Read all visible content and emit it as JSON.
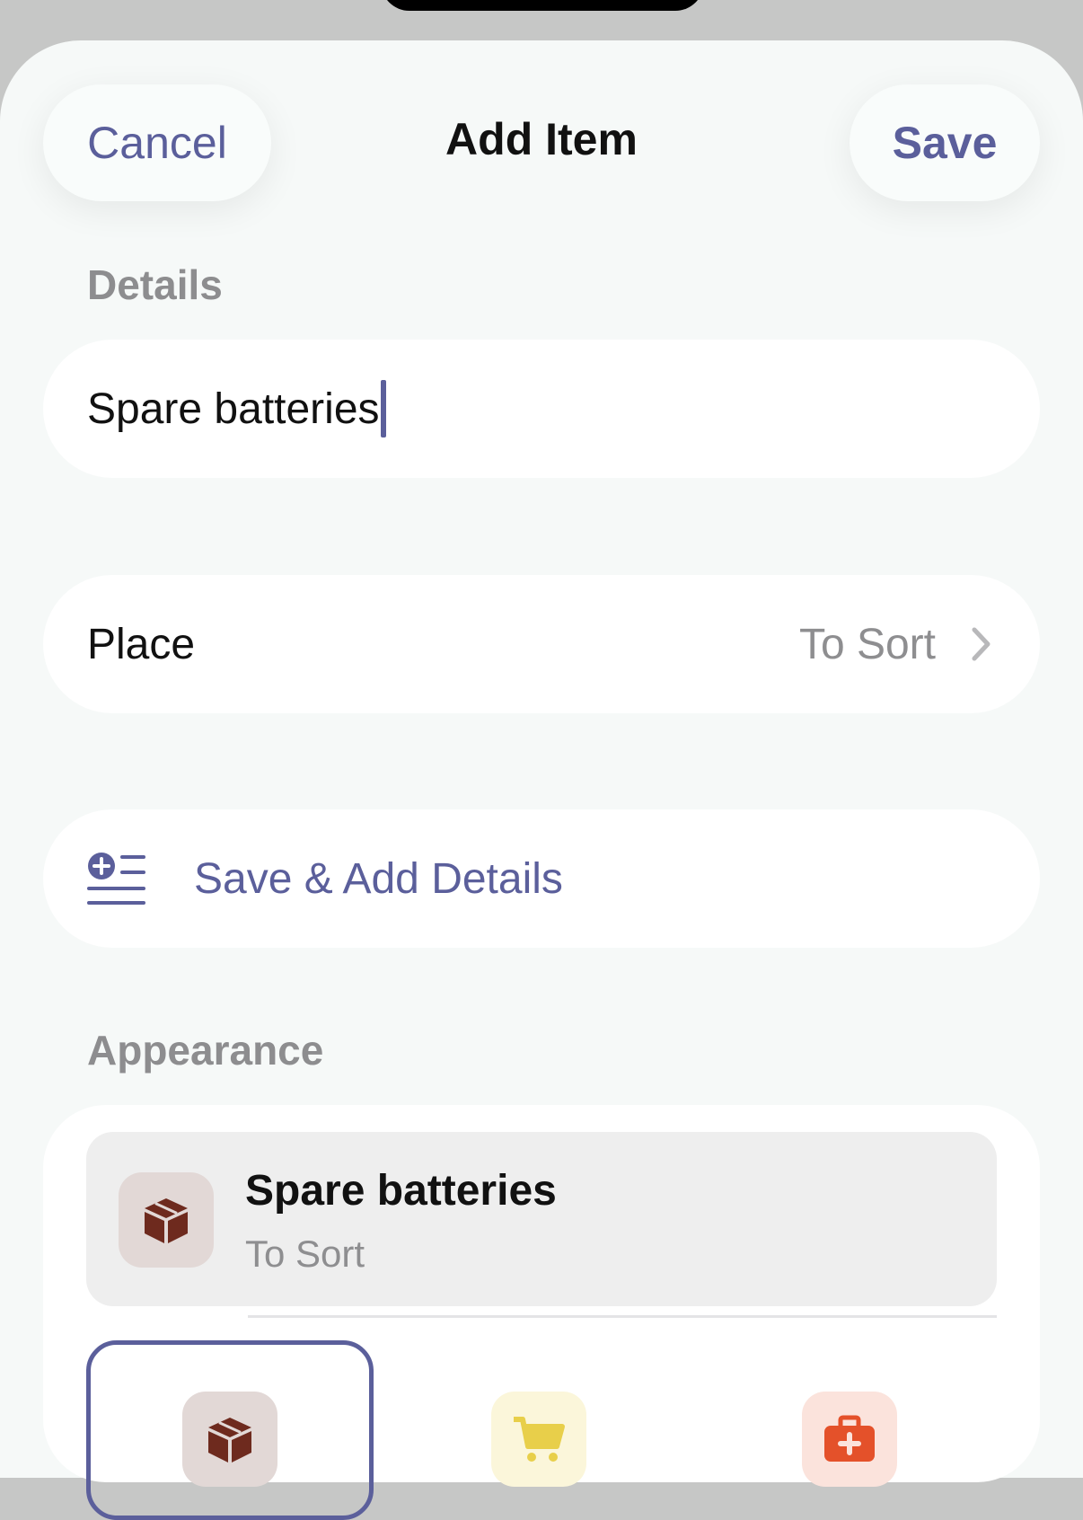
{
  "nav": {
    "cancel_label": "Cancel",
    "title": "Add Item",
    "save_label": "Save"
  },
  "details": {
    "section_label": "Details",
    "name_value": "Spare batteries",
    "place_label": "Place",
    "place_value": "To Sort",
    "add_details_label": "Save & Add Details"
  },
  "appearance": {
    "section_label": "Appearance",
    "preview_title": "Spare batteries",
    "preview_subtitle": "To Sort",
    "icon_options": [
      {
        "icon": "box-icon",
        "color": "#6e2a1e",
        "bg": "#e2d8d6",
        "selected": true
      },
      {
        "icon": "cart-icon",
        "color": "#e8cf4a",
        "bg": "#fbf6da",
        "selected": false
      },
      {
        "icon": "first-aid-kit-icon",
        "color": "#e4512a",
        "bg": "#fbe3dc",
        "selected": false
      }
    ]
  },
  "colors": {
    "accent": "#5b5f9b",
    "secondary_text": "#8e8e90",
    "background": "#f6f9f8"
  }
}
